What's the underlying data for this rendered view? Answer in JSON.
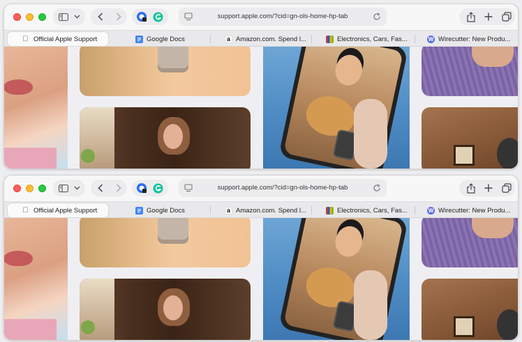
{
  "browser": {
    "url": "support.apple.com/?cid=gn-ols-home-hp-tab",
    "tabs": [
      {
        "label": "Official Apple Support",
        "icon": "apple-icon",
        "active": true
      },
      {
        "label": "Google Docs",
        "icon": "google-docs-icon",
        "active": false
      },
      {
        "label": "Amazon.com. Spend l...",
        "icon": "amazon-icon",
        "active": false
      },
      {
        "label": "Electronics, Cars, Fas...",
        "icon": "ebay-icon",
        "active": false
      },
      {
        "label": "Wirecutter: New Produ...",
        "icon": "wirecutter-icon",
        "active": false
      }
    ]
  },
  "colors": {
    "accent": "#2b6ff0",
    "amazon": "#ff9900",
    "wirecutter": "#5b6ee1",
    "traffic_red": "#fe5f57",
    "traffic_yellow": "#febc2e",
    "traffic_green": "#28c840"
  }
}
